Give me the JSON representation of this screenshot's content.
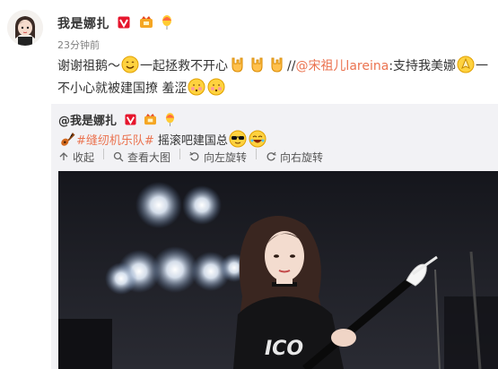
{
  "post": {
    "username": "我是娜扎",
    "time": "23分钟前",
    "text_parts": {
      "a": "谢谢祖鹅～",
      "b": "一起拯救不开心",
      "c": "//",
      "mention": "@宋祖儿lareina",
      "d": ":支持我美娜",
      "e": "一不小心就被建国撩 羞涩"
    }
  },
  "repost": {
    "username": "@我是娜扎",
    "topic": "#缝纫机乐队#",
    "text": " 摇滚吧建国总",
    "toolbar": {
      "collapse": "收起",
      "view_large": "查看大图",
      "rotate_left": "向左旋转",
      "rotate_right": "向右旋转"
    }
  },
  "icons": [
    "avatar",
    "verified-badge",
    "gold-badge",
    "balloon-badge",
    "smile-emoji",
    "rock-hand-emoji",
    "praying-hands-emoji",
    "shy-emoji",
    "guitar-icon",
    "sunglasses-emoji",
    "laugh-cry-emoji",
    "collapse-icon",
    "magnify-icon",
    "rotate-left-icon",
    "rotate-right-icon"
  ],
  "colors": {
    "accent": "#eb7350",
    "verified": "#e6162d",
    "repost_bg": "#f2f2f5"
  }
}
